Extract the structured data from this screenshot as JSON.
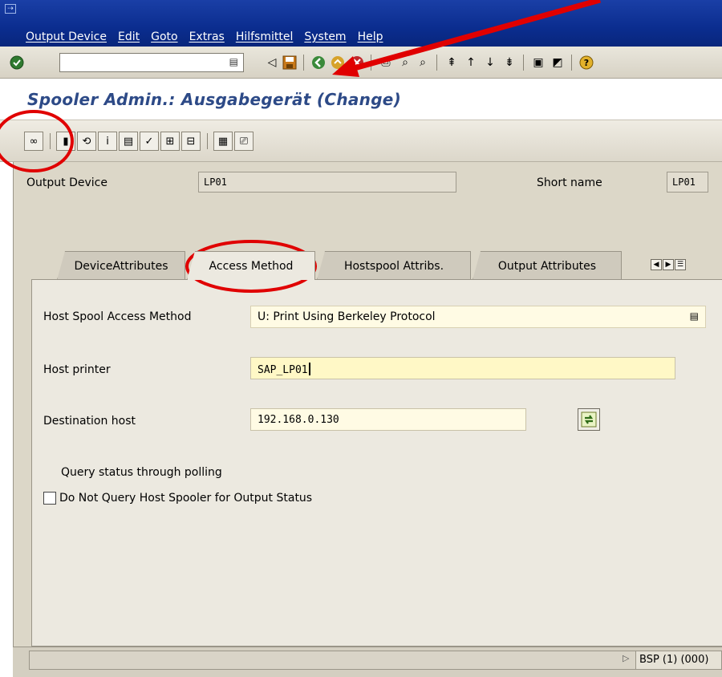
{
  "menu": {
    "items": [
      "Output Device",
      "Edit",
      "Goto",
      "Extras",
      "Hilfsmittel",
      "System",
      "Help"
    ]
  },
  "window": {
    "title": "Spooler Admin.: Ausgabegerät (Change)"
  },
  "header": {
    "output_device_label": "Output Device",
    "output_device_value": "LP01",
    "short_name_label": "Short name",
    "short_name_value": "LP01"
  },
  "tabs": [
    {
      "label": "DeviceAttributes"
    },
    {
      "label": "Access Method"
    },
    {
      "label": "Hostspool Attribs."
    },
    {
      "label": "Output Attributes"
    }
  ],
  "form": {
    "access_method_label": "Host Spool Access Method",
    "access_method_value": "U: Print Using Berkeley Protocol",
    "host_printer_label": "Host printer",
    "host_printer_value": "SAP_LP01",
    "destination_host_label": "Destination host",
    "destination_host_value": "192.168.0.130",
    "polling_label": "Query status through polling",
    "no_query_label": "Do Not Query Host Spooler for Output Status",
    "no_query_checked": false
  },
  "status": {
    "sysinfo": "BSP (1) (000)"
  },
  "colors": {
    "menubar": "#0b2d8f",
    "title": "#2d4a87",
    "annotation": "#e00000"
  },
  "icons": {
    "enter": "check-circle-icon",
    "save": "floppy-disk-icon",
    "back": "green-arrow-icon",
    "exit": "orange-circle-icon",
    "cancel": "red-x-icon",
    "help": "help-icon"
  }
}
